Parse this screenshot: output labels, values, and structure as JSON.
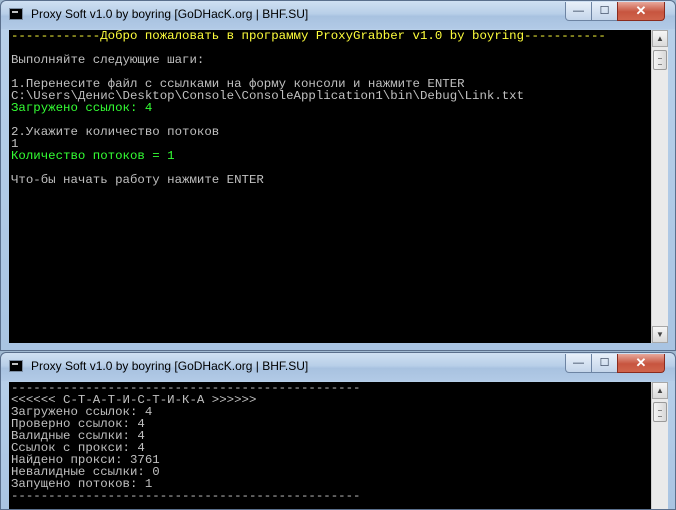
{
  "win1": {
    "title": "Proxy Soft v1.0 by boyring [GoDHacK.org | BHF.SU]",
    "controls": {
      "minimize": "—",
      "maximize": "☐",
      "close": "✕"
    },
    "lines": [
      {
        "text": "------------Добро пожаловать в программу ProxyGrabber v1.0 by boyring-----------",
        "color": "banner"
      },
      {
        "text": "",
        "color": ""
      },
      {
        "text": "Выполняйте следующие шаги:",
        "color": ""
      },
      {
        "text": "",
        "color": ""
      },
      {
        "text": "1.Перенесите файл с ссылками на форму консоли и нажмите ENTER",
        "color": ""
      },
      {
        "text": "C:\\Users\\Денис\\Desktop\\Console\\ConsoleApplication1\\bin\\Debug\\Link.txt",
        "color": ""
      },
      {
        "text": "Загружено ссылок: 4",
        "color": "green"
      },
      {
        "text": "",
        "color": ""
      },
      {
        "text": "2.Укажите количество потоков",
        "color": ""
      },
      {
        "text": "1",
        "color": ""
      },
      {
        "text": "Количество потоков = 1",
        "color": "green"
      },
      {
        "text": "",
        "color": ""
      },
      {
        "text": "Что-бы начать работу нажмите ENTER",
        "color": ""
      }
    ]
  },
  "win2": {
    "title": "Proxy Soft v1.0 by boyring [GoDHacK.org | BHF.SU]",
    "controls": {
      "minimize": "—",
      "maximize": "☐",
      "close": "✕"
    },
    "lines": [
      {
        "text": "-----------------------------------------------",
        "color": ""
      },
      {
        "text": "<<<<<< С-Т-А-Т-И-С-Т-И-К-А >>>>>>",
        "color": ""
      },
      {
        "text": "Загружено ссылок: 4",
        "color": ""
      },
      {
        "text": "Проверно ссылок: 4",
        "color": ""
      },
      {
        "text": "Валидные ссылки: 4",
        "color": ""
      },
      {
        "text": "Ссылок с прокси: 4",
        "color": ""
      },
      {
        "text": "Найдено прокси: 3761",
        "color": ""
      },
      {
        "text": "Невалидные ссылки: 0",
        "color": ""
      },
      {
        "text": "Запущено потоков: 1",
        "color": ""
      },
      {
        "text": "-----------------------------------------------",
        "color": ""
      }
    ]
  },
  "colors": {
    "console_bg": "#000000",
    "console_text": "#c0c0c0",
    "highlight_yellow": "#ffff3c",
    "highlight_green": "#34ff34"
  },
  "icons": {
    "app": "console-app-icon",
    "scroll_up": "scroll-up-arrow-icon",
    "scroll_down": "scroll-down-arrow-icon"
  },
  "scroll_arrows": {
    "up": "▲",
    "down": "▼"
  }
}
